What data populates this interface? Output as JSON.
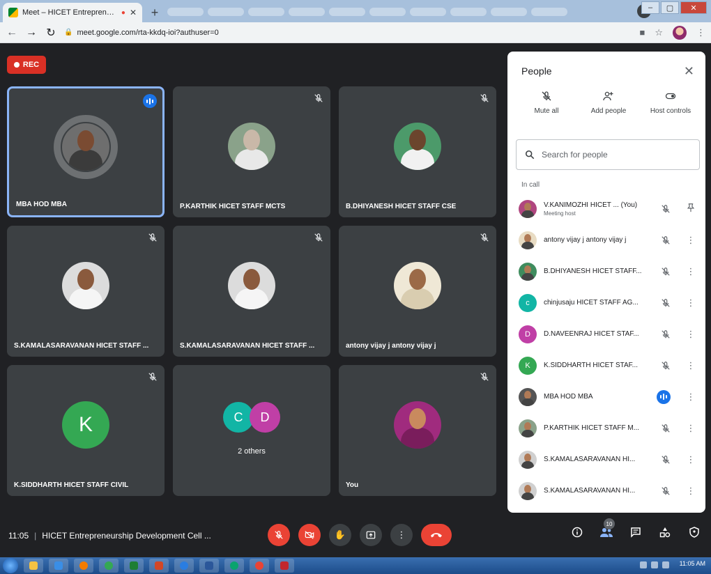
{
  "browser": {
    "tab_title": "Meet – HICET Entrepreneurs",
    "url": "meet.google.com/rta-kkdq-ioi?authuser=0"
  },
  "meet": {
    "rec_label": "REC",
    "tiles": [
      {
        "name": "MBA HOD MBA",
        "kind": "photo",
        "speaking": true,
        "skin": "#7a4b32",
        "bg": "#6e6e6e",
        "shirt": "#3b3b3b"
      },
      {
        "name": "P.KARTHIK HICET STAFF MCTS",
        "kind": "photo",
        "speaking": false,
        "skin": "#c9b8a8",
        "bg": "#8aa28a",
        "shirt": "#e8e8e8"
      },
      {
        "name": "B.DHIYANESH HICET STAFF CSE",
        "kind": "photo",
        "speaking": false,
        "skin": "#6b452d",
        "bg": "#4c9a6a",
        "shirt": "#f1f1f1"
      },
      {
        "name": "S.KAMALASARAVANAN HICET STAFF ...",
        "kind": "photo",
        "speaking": false,
        "skin": "#8a5a3d",
        "bg": "#dcdcdc",
        "shirt": "#f5f5f5"
      },
      {
        "name": "S.KAMALASARAVANAN HICET STAFF ...",
        "kind": "photo",
        "speaking": false,
        "skin": "#8a5a3d",
        "bg": "#dcdcdc",
        "shirt": "#f5f5f5"
      },
      {
        "name": "antony vijay j antony vijay j",
        "kind": "photo",
        "speaking": false,
        "skin": "#9b6a47",
        "bg": "#efe8d6",
        "shirt": "#d9cdb0"
      },
      {
        "name": "K.SIDDHARTH HICET STAFF CIVIL",
        "kind": "letter",
        "letter": "K",
        "color": "#34a853"
      },
      {
        "name": "",
        "kind": "others",
        "others_label": "2 others",
        "letters": [
          {
            "l": "C",
            "color": "#12b5a5"
          },
          {
            "l": "D",
            "color": "#c03fa6"
          }
        ]
      },
      {
        "name": "You",
        "kind": "photo",
        "speaking": false,
        "skin": "#c98a5e",
        "bg": "#a02b7e",
        "shirt": "#7a1d5c"
      }
    ],
    "meeting_time": "11:05",
    "meeting_title": "HICET Entrepreneurship Development Cell ...",
    "participant_count": "10"
  },
  "people_panel": {
    "title": "People",
    "actions": {
      "mute_all": "Mute all",
      "add_people": "Add people",
      "host_controls": "Host controls"
    },
    "search_placeholder": "Search for people",
    "section_label": "In call",
    "participants": [
      {
        "name": "V.KANIMOZHI HICET ... (You)",
        "sub": "Meeting host",
        "avatar": "photo",
        "color": "#b0467f",
        "trailing": "pin"
      },
      {
        "name": "antony vijay j antony vijay j",
        "avatar": "photo",
        "color": "#e8dcc4",
        "trailing": "more"
      },
      {
        "name": "B.DHIYANESH HICET STAFF...",
        "avatar": "photo",
        "color": "#3f8c5e",
        "trailing": "more"
      },
      {
        "name": "chinjusaju HICET STAFF AG...",
        "avatar": "letter",
        "letter": "c",
        "color": "#12b5a5",
        "trailing": "more"
      },
      {
        "name": "D.NAVEENRAJ HICET STAF...",
        "avatar": "letter",
        "letter": "D",
        "color": "#c03fa6",
        "trailing": "more"
      },
      {
        "name": "K.SIDDHARTH HICET STAF...",
        "avatar": "letter",
        "letter": "K",
        "color": "#34a853",
        "trailing": "more"
      },
      {
        "name": "MBA HOD MBA",
        "avatar": "photo",
        "color": "#555555",
        "trailing": "more",
        "speaking": true
      },
      {
        "name": "P.KARTHIK HICET STAFF M...",
        "avatar": "photo",
        "color": "#8aa28a",
        "trailing": "more"
      },
      {
        "name": "S.KAMALASARAVANAN HI...",
        "avatar": "photo",
        "color": "#d0d0d0",
        "trailing": "more"
      },
      {
        "name": "S.KAMALASARAVANAN HI...",
        "avatar": "photo",
        "color": "#d0d0d0",
        "trailing": "more"
      }
    ]
  },
  "taskbar": {
    "clock": "11:05 AM"
  },
  "colors": {
    "accent": "#1a73e8",
    "danger": "#ea4335",
    "tile": "#3c4043",
    "stage": "#202124"
  }
}
